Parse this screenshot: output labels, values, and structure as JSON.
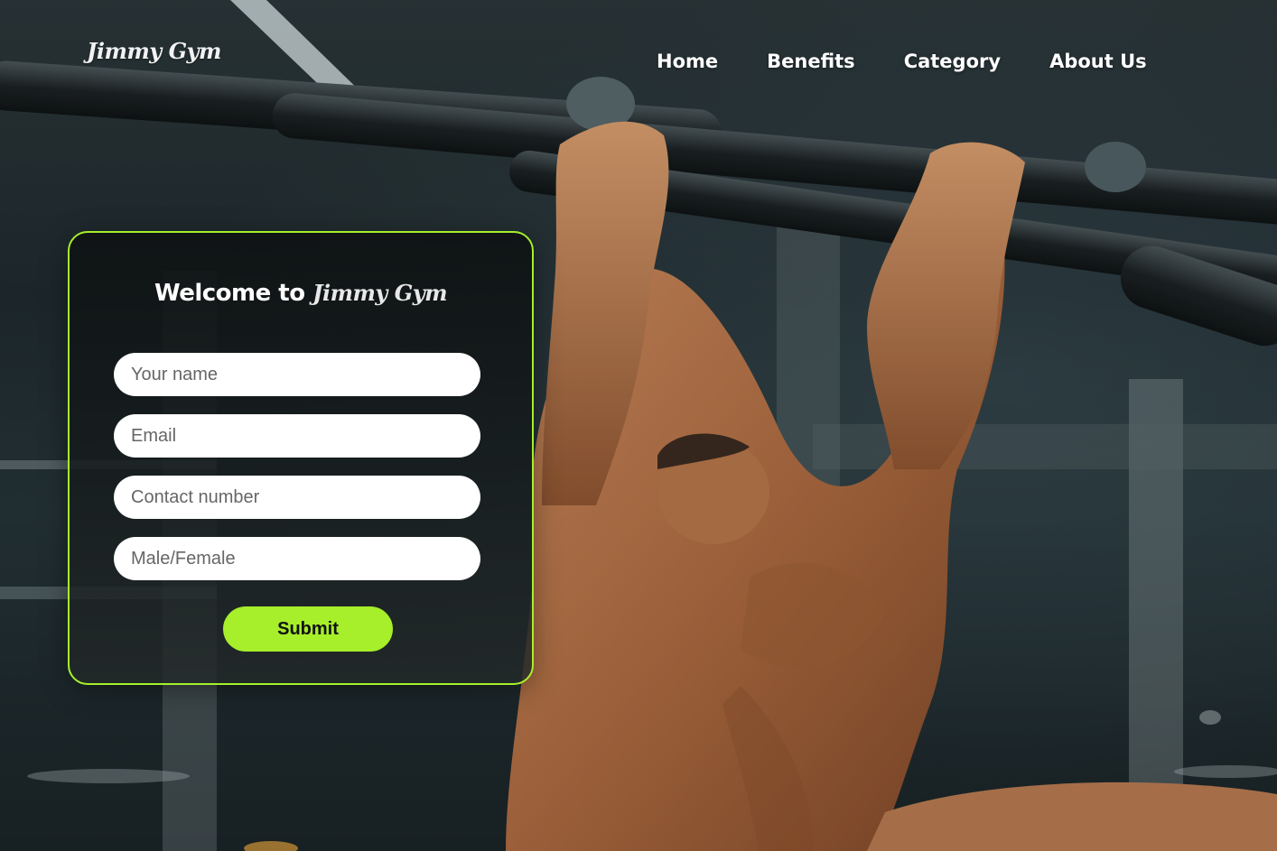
{
  "brand": {
    "logo_text": "Jimmy Gym"
  },
  "nav": {
    "items": [
      {
        "label": "Home"
      },
      {
        "label": "Benefits"
      },
      {
        "label": "Category"
      },
      {
        "label": "About Us"
      }
    ]
  },
  "form": {
    "title_prefix": "Welcome to",
    "title_brand": "Jimmy Gym",
    "fields": [
      {
        "placeholder": "Your name",
        "value": ""
      },
      {
        "placeholder": "Email",
        "value": ""
      },
      {
        "placeholder": "Contact number",
        "value": ""
      },
      {
        "placeholder": "Male/Female",
        "value": ""
      }
    ],
    "submit_label": "Submit"
  },
  "colors": {
    "accent": "#a6ef2a",
    "text_light": "#ffffff",
    "card_background": "#121718"
  },
  "background": {
    "description_icon": "athlete-pullup-photo"
  }
}
